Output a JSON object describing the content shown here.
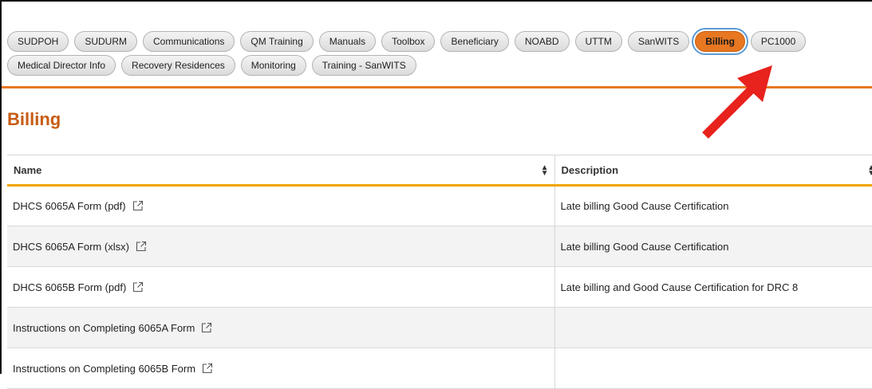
{
  "tabs": {
    "row1": [
      "SUDPOH",
      "SUDURM",
      "Communications",
      "QM Training",
      "Manuals",
      "Toolbox",
      "Beneficiary",
      "NOABD",
      "UTTM",
      "SanWITS",
      "Billing",
      "PC1000"
    ],
    "row2": [
      "Medical Director Info",
      "Recovery Residences",
      "Monitoring",
      "Training - SanWITS"
    ],
    "active": "Billing"
  },
  "page": {
    "title": "Billing"
  },
  "table": {
    "headers": {
      "name": "Name",
      "description": "Description"
    },
    "rows": [
      {
        "name": "DHCS 6065A Form (pdf)",
        "description": "Late billing Good Cause Certification"
      },
      {
        "name": "DHCS 6065A Form (xlsx)",
        "description": "Late billing Good Cause Certification"
      },
      {
        "name": "DHCS 6065B Form (pdf)",
        "description": "Late billing and Good Cause Certification for DRC 8"
      },
      {
        "name": "Instructions on Completing 6065A Form",
        "description": ""
      },
      {
        "name": "Instructions on Completing 6065B Form",
        "description": ""
      }
    ]
  },
  "colors": {
    "accent": "#e87722",
    "title": "#c75b12",
    "header_rule": "#f0a500",
    "arrow": "#e8221c"
  },
  "icons": {
    "external_link": "external-link-icon",
    "sort": "sort-icon",
    "annotation": "red-arrow"
  }
}
